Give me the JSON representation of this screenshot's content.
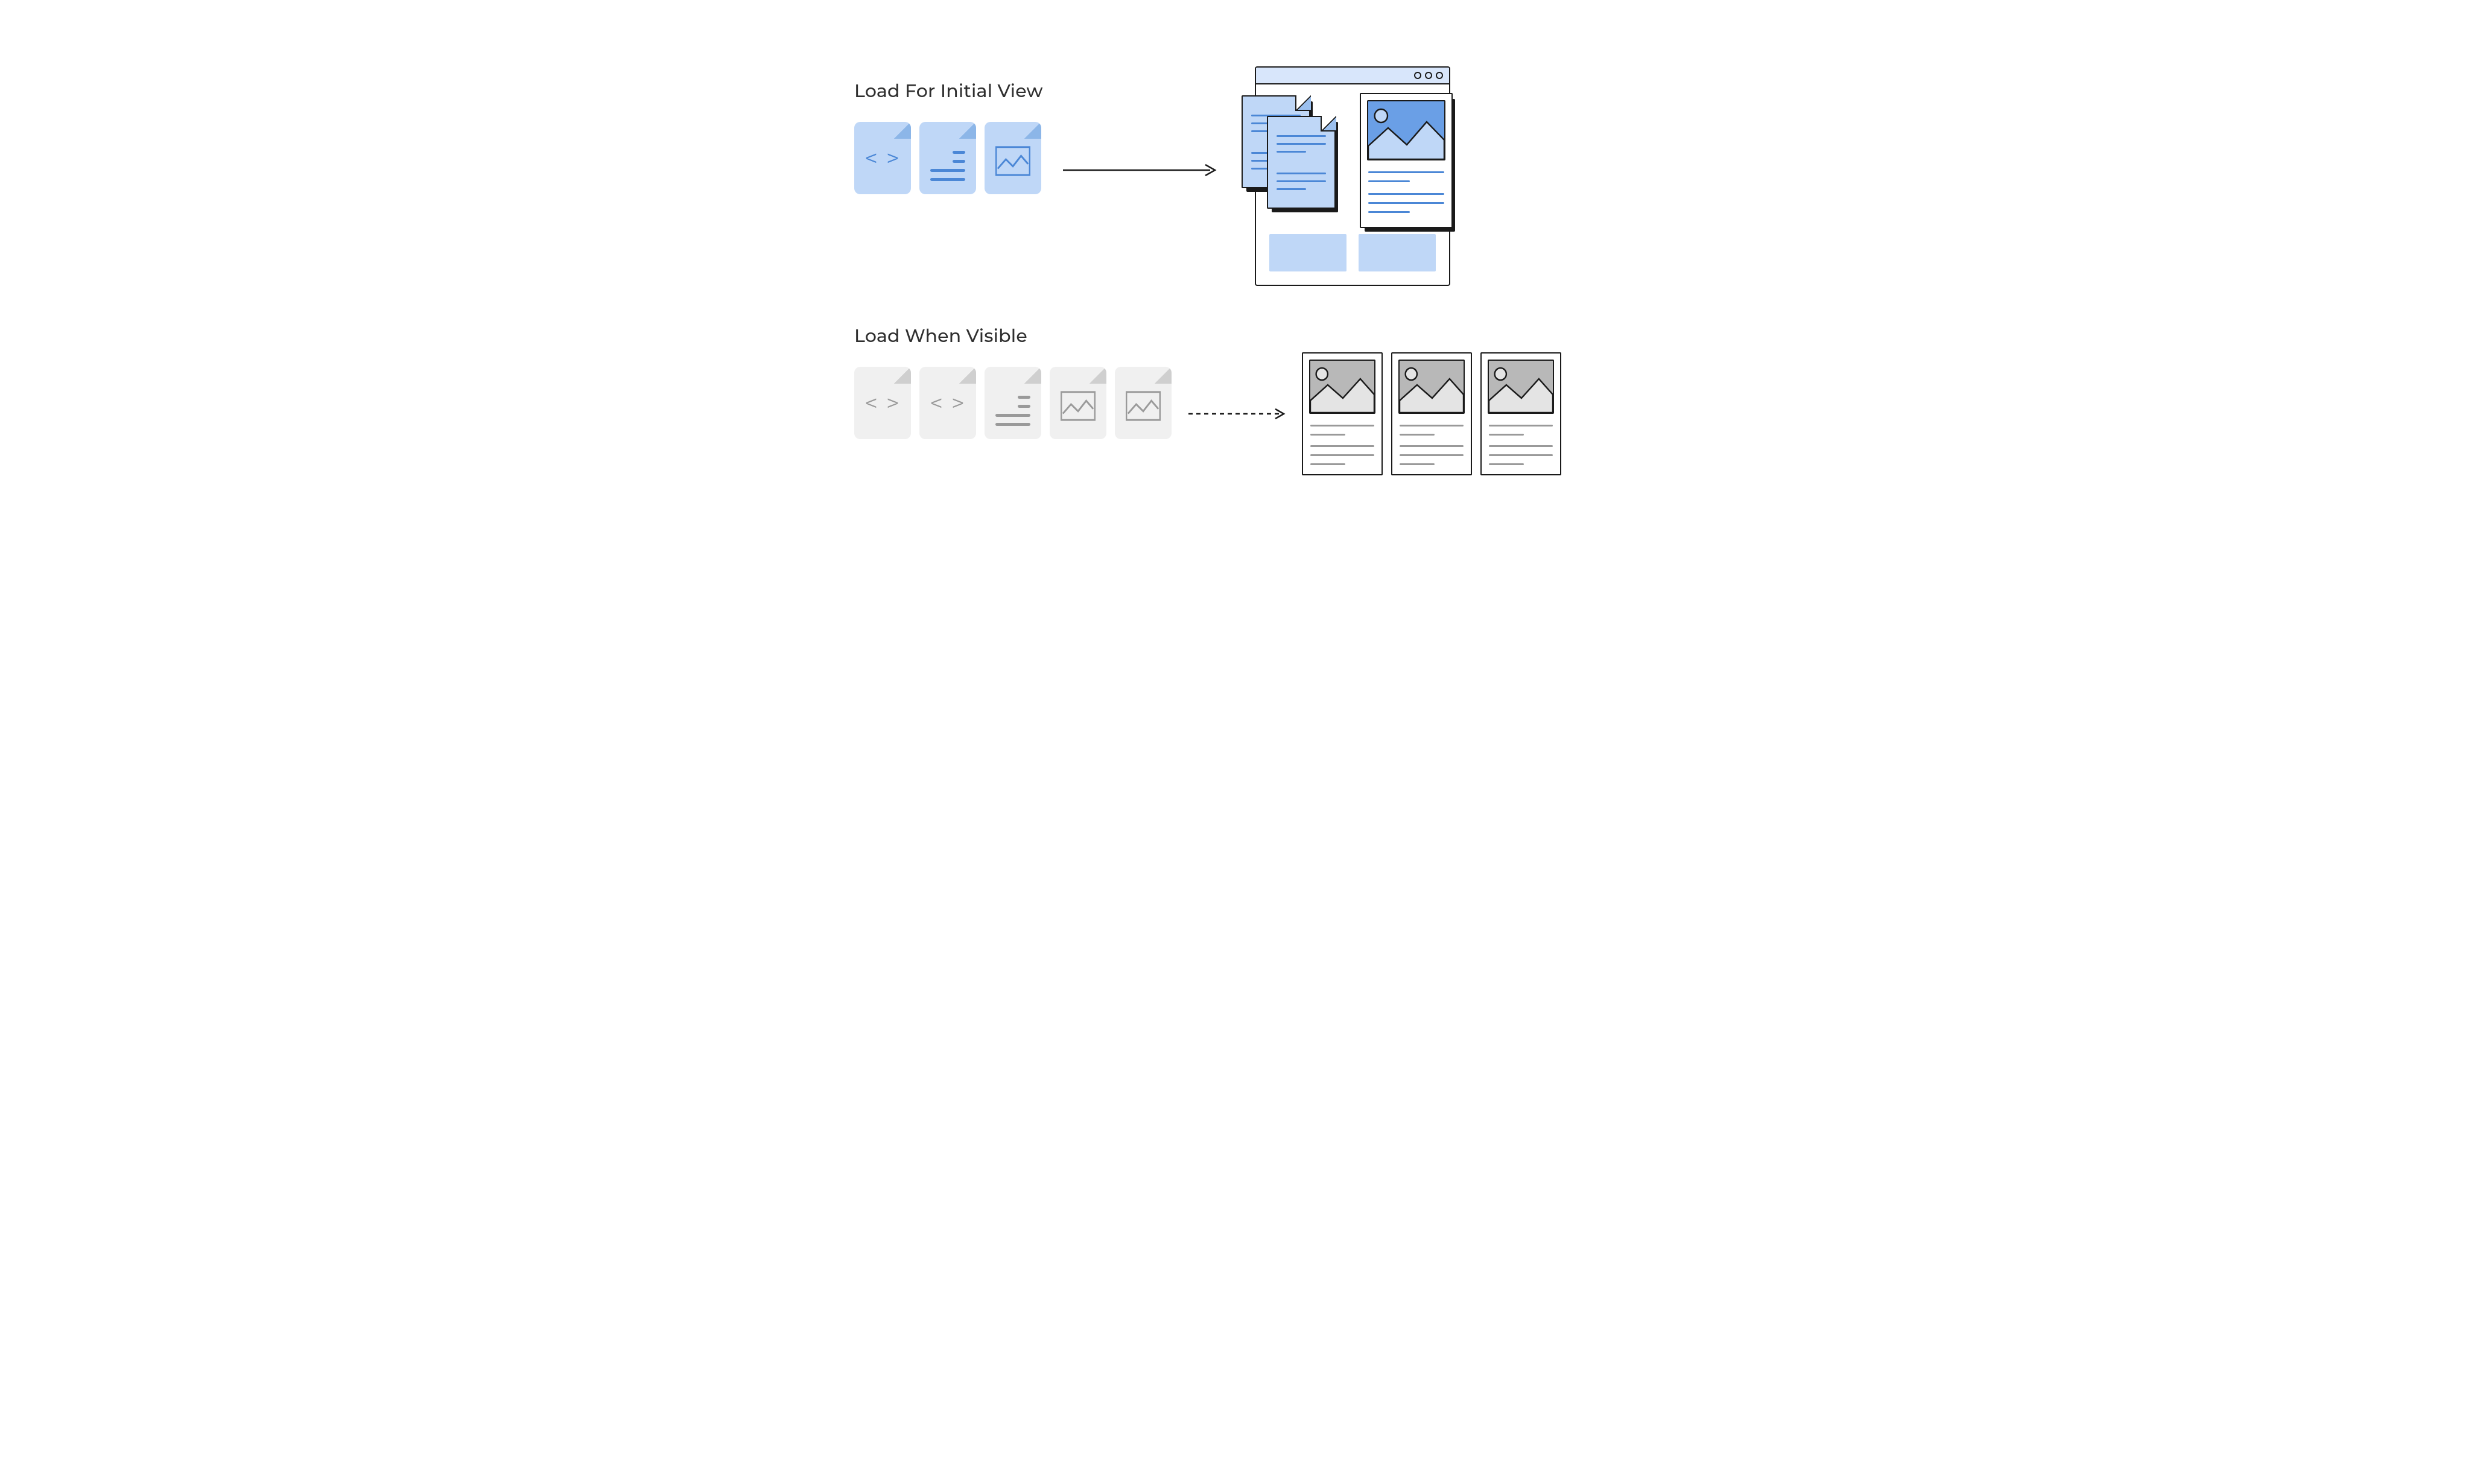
{
  "headings": {
    "initial": "Load For Initial View",
    "lazy": "Load When Visible"
  },
  "icons": {
    "code": "code-file-icon",
    "text": "text-file-icon",
    "image": "image-file-icon",
    "arrow_solid": "arrow-right-icon",
    "arrow_dashed": "arrow-right-dashed-icon",
    "browser": "browser-window-icon",
    "card": "content-card-icon"
  },
  "colors": {
    "blue_fill": "#bfd7f7",
    "blue_stroke": "#4b87d6",
    "blue_dark": "#6a9fe6",
    "grey_fill": "#f0f0f0",
    "grey_stroke": "#9a9a9a",
    "ink": "#1a1a1a"
  },
  "diagram": {
    "initial_files": [
      "code",
      "text",
      "image"
    ],
    "lazy_files": [
      "code",
      "code",
      "text",
      "image",
      "image"
    ],
    "lazy_cards_count": 3
  }
}
